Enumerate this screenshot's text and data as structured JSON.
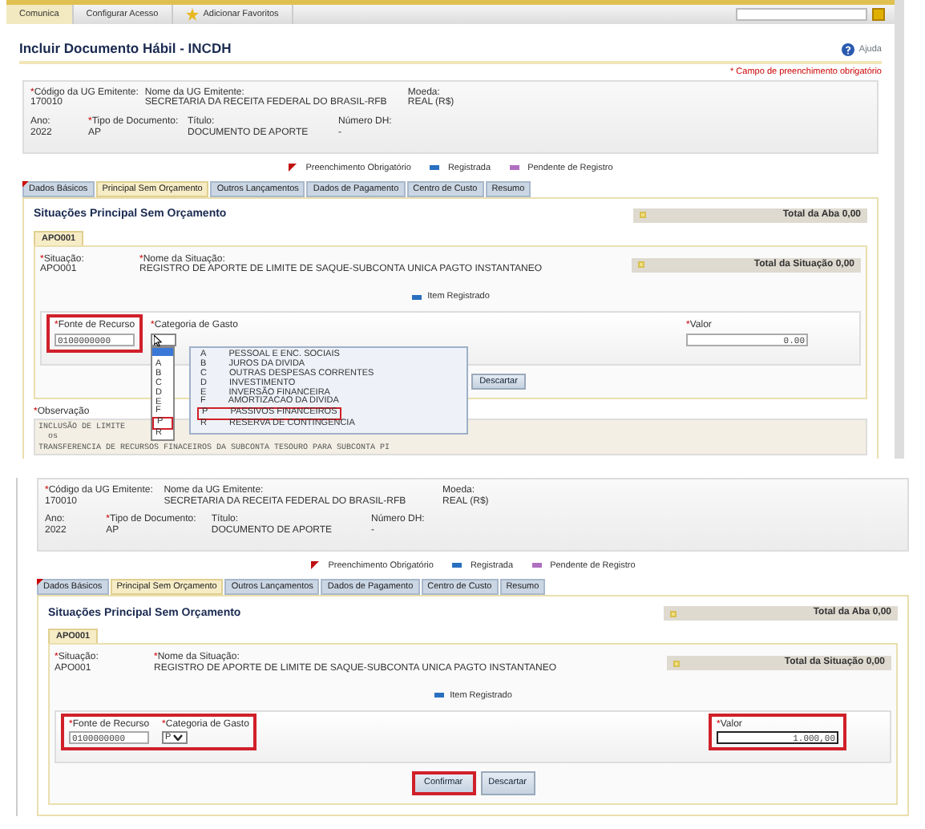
{
  "required_mark": "*",
  "screens": [
    {
      "toolbar": {
        "tabs": [
          {
            "label": "Comunica",
            "selected": true,
            "starred": false
          },
          {
            "label": "Configurar Acesso",
            "selected": false,
            "starred": false
          },
          {
            "label": "Adicionar Favoritos",
            "selected": false,
            "starred": true
          }
        ]
      },
      "title": "Incluir Documento Hábil - INCDH",
      "help": "Ajuda",
      "required_note": "* Campo de preenchimento obrigatório",
      "header_rows": [
        [
          {
            "label": "Código da UG Emitente:",
            "value": "170010",
            "required": true
          },
          {
            "label": "Nome da UG Emitente:",
            "value": "SECRETARIA DA RECEITA FEDERAL DO BRASIL-RFB",
            "required": false
          },
          {
            "label": "Moeda:",
            "value": "REAL (R$)",
            "required": false
          }
        ],
        [
          {
            "label": "Ano:",
            "value": "2022",
            "required": false
          },
          {
            "label": "Tipo de Documento:",
            "value": "AP",
            "required": true
          },
          {
            "label": "Título:",
            "value": "DOCUMENTO DE APORTE",
            "required": false
          },
          {
            "label": "Número DH:",
            "value": "-",
            "required": false
          }
        ]
      ],
      "legend": [
        {
          "label": "Preenchimento Obrigatório",
          "kind": "required"
        },
        {
          "label": "Registrada",
          "kind": "registered"
        },
        {
          "label": "Pendente de Registro",
          "kind": "pending"
        }
      ],
      "tabs": [
        {
          "label": "Dados Básicos",
          "selected": false,
          "required": true
        },
        {
          "label": "Principal Sem Orçamento",
          "selected": true,
          "required": false
        },
        {
          "label": "Outros Lançamentos",
          "selected": false,
          "required": false
        },
        {
          "label": "Dados de Pagamento",
          "selected": false,
          "required": false
        },
        {
          "label": "Centro de Custo",
          "selected": false,
          "required": false
        },
        {
          "label": "Resumo",
          "selected": false,
          "required": false
        }
      ],
      "section_title": "Situações Principal Sem Orçamento",
      "total_aba": "Total da Aba 0,00",
      "situation_tab": "APO001",
      "situation": [
        {
          "label": "Situação:",
          "value": "APO001",
          "required": true
        },
        {
          "label": "Nome da Situação:",
          "value": "REGISTRO DE APORTE DE LIMITE DE SAQUE-SUBCONTA UNICA PAGTO INSTANTANEO",
          "required": true
        }
      ],
      "total_situacao": "Total da Situação 0,00",
      "item_status": "Item Registrado",
      "field_groups": [
        {
          "highlighted": true,
          "fields": [
            {
              "kind": "text",
              "label": "Fonte de Recurso",
              "value": "0100000000",
              "required": true,
              "focused": false
            }
          ]
        },
        {
          "highlighted": false,
          "fields": [
            {
              "kind": "select",
              "label": "Categoria de Gasto",
              "required": true,
              "focused": false,
              "dropdown": {
                "options": [
                  {
                    "label": "A",
                    "highlighted": false
                  },
                  {
                    "label": "B",
                    "highlighted": false
                  },
                  {
                    "label": "C",
                    "highlighted": false
                  },
                  {
                    "label": "D",
                    "highlighted": false
                  },
                  {
                    "label": "E",
                    "highlighted": false
                  },
                  {
                    "label": "F",
                    "highlighted": false
                  },
                  {
                    "label": "P",
                    "highlighted": true
                  },
                  {
                    "label": "R",
                    "highlighted": false
                  }
                ],
                "hints": [
                  {
                    "code": "A",
                    "name": "PESSOAL E ENC. SOCIAIS",
                    "highlighted": false
                  },
                  {
                    "code": "B",
                    "name": "JUROS DA DIVIDA",
                    "highlighted": false
                  },
                  {
                    "code": "C",
                    "name": "OUTRAS DESPESAS CORRENTES",
                    "highlighted": false
                  },
                  {
                    "code": "D",
                    "name": "INVESTIMENTO",
                    "highlighted": false
                  },
                  {
                    "code": "E",
                    "name": "INVERSÃO FINANCEIRA",
                    "highlighted": false
                  },
                  {
                    "code": "F",
                    "name": "AMORTIZACAO DA DIVIDA",
                    "highlighted": false
                  },
                  {
                    "code": "P",
                    "name": "PASSIVOS FINANCEIROS",
                    "highlighted": true
                  },
                  {
                    "code": "R",
                    "name": "RESERVA DE CONTINGENCIA",
                    "highlighted": false
                  }
                ]
              }
            }
          ]
        },
        {
          "highlighted": false,
          "fields": [
            {
              "kind": "number",
              "label": "Valor",
              "value": "0.00",
              "required": true,
              "focused": false
            }
          ]
        }
      ],
      "buttons": [
        {
          "label": "Descartar",
          "highlighted": false
        }
      ],
      "observacao": {
        "label": "Observação",
        "required": true,
        "lines": [
          "INCLUSÃO DE LIMITE",
          "  os",
          "TRANSFERENCIA DE RECURSOS FINACEIROS DA SUBCONTA TESOURO PARA SUBCONTA PI"
        ]
      }
    },
    {
      "header_rows": [
        [
          {
            "label": "Código da UG Emitente:",
            "value": "170010",
            "required": true
          },
          {
            "label": "Nome da UG Emitente:",
            "value": "SECRETARIA DA RECEITA FEDERAL DO BRASIL-RFB",
            "required": false
          },
          {
            "label": "Moeda:",
            "value": "REAL (R$)",
            "required": false
          }
        ],
        [
          {
            "label": "Ano:",
            "value": "2022",
            "required": false
          },
          {
            "label": "Tipo de Documento:",
            "value": "AP",
            "required": true
          },
          {
            "label": "Título:",
            "value": "DOCUMENTO DE APORTE",
            "required": false
          },
          {
            "label": "Número DH:",
            "value": "-",
            "required": false
          }
        ]
      ],
      "legend": [
        {
          "label": "Preenchimento Obrigatório",
          "kind": "required"
        },
        {
          "label": "Registrada",
          "kind": "registered"
        },
        {
          "label": "Pendente de Registro",
          "kind": "pending"
        }
      ],
      "tabs": [
        {
          "label": "Dados Básicos",
          "selected": false,
          "required": true
        },
        {
          "label": "Principal Sem Orçamento",
          "selected": true,
          "required": false
        },
        {
          "label": "Outros Lançamentos",
          "selected": false,
          "required": false
        },
        {
          "label": "Dados de Pagamento",
          "selected": false,
          "required": false
        },
        {
          "label": "Centro de Custo",
          "selected": false,
          "required": false
        },
        {
          "label": "Resumo",
          "selected": false,
          "required": false
        }
      ],
      "section_title": "Situações Principal Sem Orçamento",
      "total_aba": "Total da Aba 0,00",
      "situation_tab": "APO001",
      "situation": [
        {
          "label": "Situação:",
          "value": "APO001",
          "required": true
        },
        {
          "label": "Nome da Situação:",
          "value": "REGISTRO DE APORTE DE LIMITE DE SAQUE-SUBCONTA UNICA PAGTO INSTANTANEO",
          "required": true
        }
      ],
      "total_situacao": "Total da Situação 0,00",
      "item_status": "Item Registrado",
      "field_groups": [
        {
          "highlighted": true,
          "fields": [
            {
              "kind": "text",
              "label": "Fonte de Recurso",
              "value": "0100000000",
              "required": true,
              "focused": false
            },
            {
              "kind": "select",
              "label": "Categoria de Gasto",
              "value": "P",
              "required": true,
              "focused": false
            }
          ]
        },
        {
          "highlighted": true,
          "fields": [
            {
              "kind": "number",
              "label": "Valor",
              "value": "1.000,00",
              "required": true,
              "focused": true
            }
          ]
        }
      ],
      "buttons": [
        {
          "label": "Confirmar",
          "highlighted": true
        },
        {
          "label": "Descartar",
          "highlighted": false
        }
      ]
    }
  ]
}
